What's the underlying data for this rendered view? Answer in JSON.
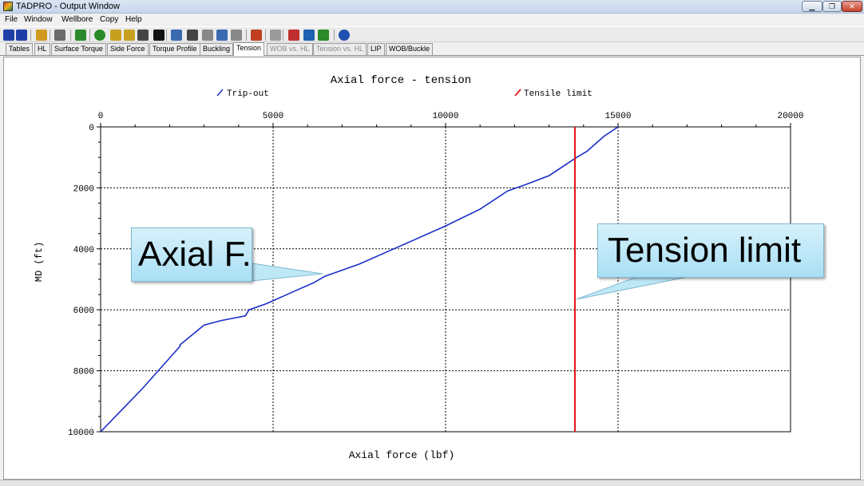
{
  "window": {
    "title": "TADPRO - Output Window",
    "controls": {
      "minimize": "▁",
      "maximize": "❐",
      "close": "✕"
    }
  },
  "menu": {
    "items": [
      "File",
      "Window",
      "Wellbore",
      "Copy",
      "Help"
    ]
  },
  "toolbar": {
    "icons": [
      {
        "name": "open-table-icon",
        "color": "#1f3fa8"
      },
      {
        "name": "save-table-icon",
        "color": "#1f3fa8"
      },
      {
        "name": "export-icon",
        "color": "#d09a20"
      },
      {
        "name": "print-icon",
        "color": "#6a6a6a"
      },
      {
        "name": "back-icon",
        "color": "#2a8a2a"
      },
      {
        "name": "refresh-icon",
        "color": "#2a8a2a"
      },
      {
        "name": "rig-icon",
        "color": "#c8a020"
      },
      {
        "name": "rig-alt-icon",
        "color": "#c8a020"
      },
      {
        "name": "stack-icon",
        "color": "#444444"
      },
      {
        "name": "terminal-icon",
        "color": "#111111"
      },
      {
        "name": "chart-settings-icon",
        "color": "#3a6ab0"
      },
      {
        "name": "camera-icon",
        "color": "#444444"
      },
      {
        "name": "grid-icon",
        "color": "#888888"
      },
      {
        "name": "table-view-icon",
        "color": "#3a6ab0"
      },
      {
        "name": "zoom-icon",
        "color": "#888888"
      },
      {
        "name": "tool-icon",
        "color": "#c04020"
      },
      {
        "name": "disabled-icon",
        "color": "#9a9a9a"
      },
      {
        "name": "units-icon",
        "color": "#c03030"
      },
      {
        "name": "monitor-icon",
        "color": "#2060b0"
      },
      {
        "name": "turtle-icon",
        "color": "#2a8a2a"
      },
      {
        "name": "help-icon",
        "color": "#1f4fb0"
      }
    ]
  },
  "tabs": [
    {
      "label": "Tables",
      "active": false,
      "disabled": false
    },
    {
      "label": "HL",
      "active": false,
      "disabled": false
    },
    {
      "label": "Surface Torque",
      "active": false,
      "disabled": false
    },
    {
      "label": "Side Force",
      "active": false,
      "disabled": false
    },
    {
      "label": "Torque Profile",
      "active": false,
      "disabled": false
    },
    {
      "label": "Buckling",
      "active": false,
      "disabled": false
    },
    {
      "label": "Tension",
      "active": true,
      "disabled": false
    },
    {
      "label": "WOB vs. HL",
      "active": false,
      "disabled": true
    },
    {
      "label": "Tension vs. HL",
      "active": false,
      "disabled": true
    },
    {
      "label": "LIP",
      "active": false,
      "disabled": false
    },
    {
      "label": "WOB/Buckle",
      "active": false,
      "disabled": false
    }
  ],
  "chart_data": {
    "type": "line",
    "title": "Axial force - tension",
    "xlabel": "Axial force (lbf)",
    "ylabel": "MD (ft)",
    "xlim": [
      0,
      20000
    ],
    "ylim": [
      0,
      10000
    ],
    "y_inverted": true,
    "x_axis_position": "top",
    "xticks": [
      0,
      5000,
      10000,
      15000,
      20000
    ],
    "yticks": [
      0,
      2000,
      4000,
      6000,
      8000,
      10000
    ],
    "grid": true,
    "legend_position": "top",
    "series": [
      {
        "name": "Trip-out",
        "color": "#1a2fc8",
        "points": [
          [
            0,
            10000
          ],
          [
            1200,
            8600
          ],
          [
            2300,
            7200
          ],
          [
            2300,
            7150
          ],
          [
            3000,
            6500
          ],
          [
            3500,
            6350
          ],
          [
            4200,
            6200
          ],
          [
            4300,
            6000
          ],
          [
            4800,
            5800
          ],
          [
            5500,
            5450
          ],
          [
            6200,
            5100
          ],
          [
            6500,
            4900
          ],
          [
            7500,
            4500
          ],
          [
            8500,
            4000
          ],
          [
            9000,
            3750
          ],
          [
            10000,
            3250
          ],
          [
            11000,
            2700
          ],
          [
            11800,
            2100
          ],
          [
            12300,
            1900
          ],
          [
            13000,
            1600
          ],
          [
            13800,
            1000
          ],
          [
            14100,
            800
          ],
          [
            14300,
            600
          ],
          [
            14600,
            300
          ],
          [
            15000,
            0
          ]
        ]
      },
      {
        "name": "Tensile limit",
        "color": "#e01818",
        "points": [
          [
            13750,
            0
          ],
          [
            13750,
            10000
          ]
        ]
      }
    ]
  },
  "annotations": {
    "axial": "Axial F.",
    "tension": "Tension limit"
  }
}
